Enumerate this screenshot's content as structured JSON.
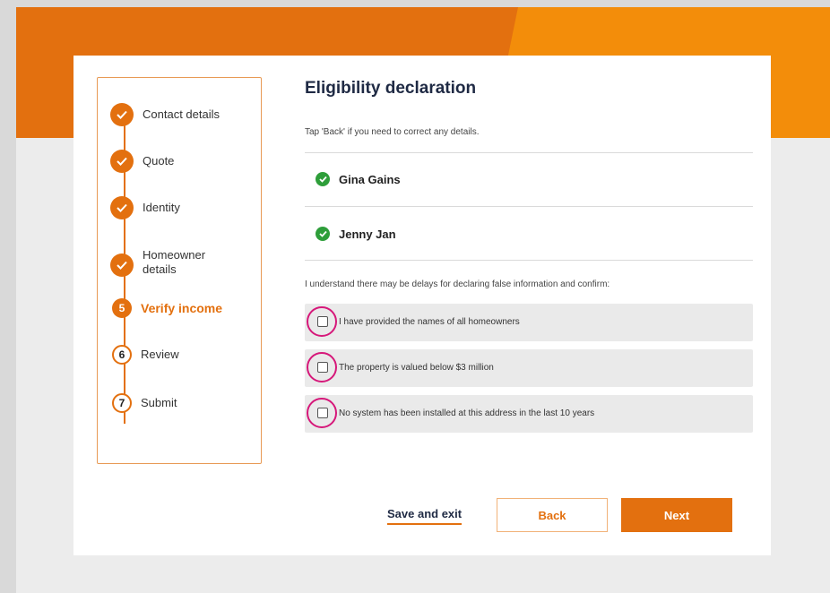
{
  "steps": [
    {
      "label": "Contact details",
      "state": "done"
    },
    {
      "label": "Quote",
      "state": "done"
    },
    {
      "label": "Identity",
      "state": "done"
    },
    {
      "label": "Homeowner details",
      "state": "done"
    },
    {
      "label": "Verify income",
      "number": "5",
      "state": "current"
    },
    {
      "label": "Review",
      "number": "6",
      "state": "todo"
    },
    {
      "label": "Submit",
      "number": "7",
      "state": "todo"
    }
  ],
  "main": {
    "title": "Eligibility declaration",
    "hint": "Tap 'Back' if you need to correct any details.",
    "homeowners": [
      "Gina Gains",
      "Jenny Jan"
    ],
    "declaration_intro": "I understand there may be delays for declaring false information and confirm:",
    "confirmations": [
      {
        "label": "I have provided the names of all homeowners",
        "checked": false
      },
      {
        "label": "The property is valued below $3 million",
        "checked": false
      },
      {
        "label": "No system has been installed at this address in the last 10 years",
        "checked": false
      }
    ]
  },
  "footer": {
    "save_label": "Save and exit",
    "back_label": "Back",
    "next_label": "Next"
  },
  "colors": {
    "brand_orange": "#e3700f",
    "banner_light_orange": "#f38d0a",
    "success_green": "#2e9e3a",
    "highlight_ring": "#d6187a"
  }
}
